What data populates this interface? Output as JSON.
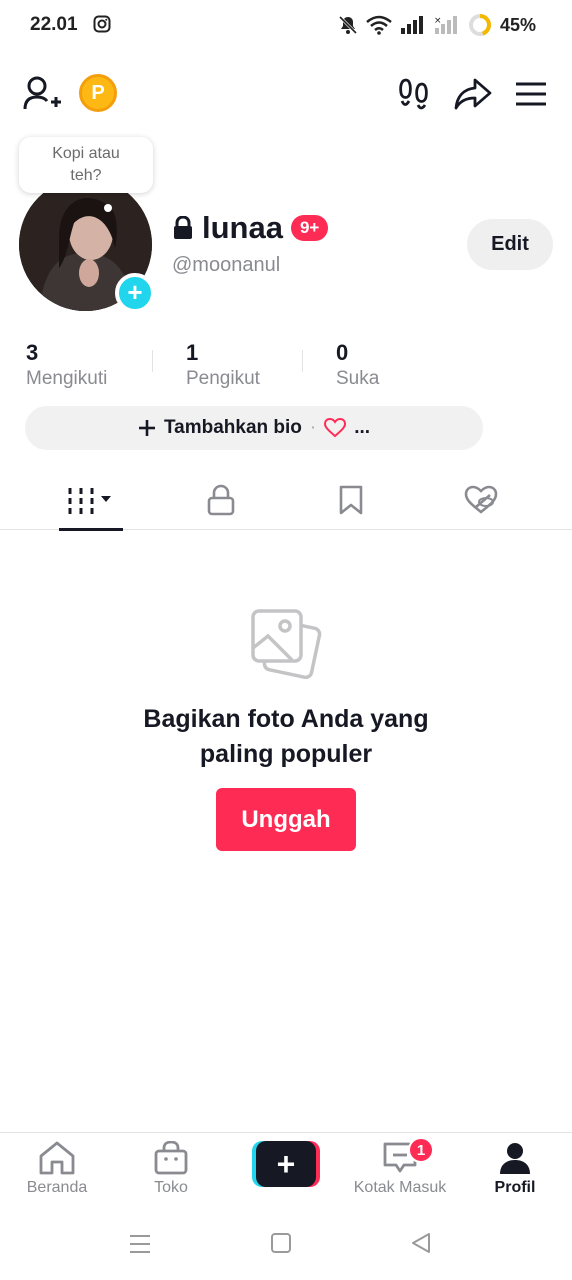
{
  "status_bar": {
    "time": "22.01",
    "battery": "45%"
  },
  "profile": {
    "bubble_text": "Kopi atau teh?",
    "name": "lunaa",
    "badge": "9+",
    "handle": "@moonanul",
    "edit_label": "Edit"
  },
  "stats": [
    {
      "value": "3",
      "label": "Mengikuti"
    },
    {
      "value": "1",
      "label": "Pengikut"
    },
    {
      "value": "0",
      "label": "Suka"
    }
  ],
  "bio": {
    "label": "Tambahkan bio",
    "dot": "·",
    "more": "..."
  },
  "empty_state": {
    "title_line1": "Bagikan foto Anda yang",
    "title_line2": "paling populer",
    "button": "Unggah"
  },
  "bottom_nav": {
    "home": "Beranda",
    "shop": "Toko",
    "inbox": "Kotak Masuk",
    "inbox_badge": "1",
    "profile": "Profil"
  },
  "colors": {
    "accent": "#FE2C55",
    "cyan": "#20D5EC",
    "coin": "#FDB813"
  }
}
